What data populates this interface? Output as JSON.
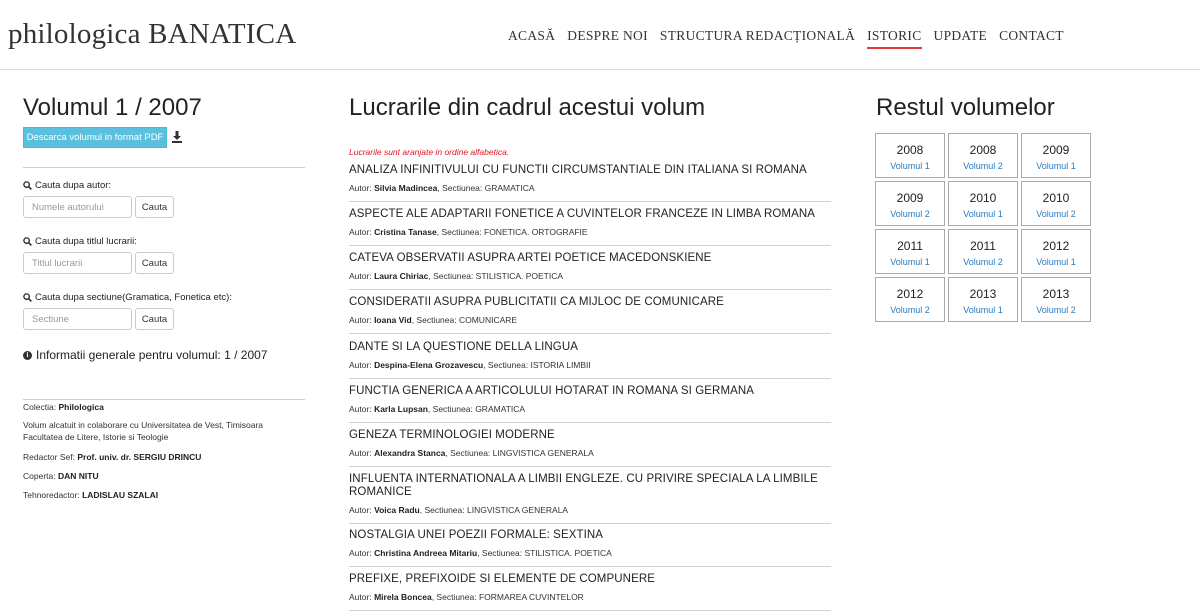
{
  "site": {
    "logo": "philologica BANATICA",
    "nav": [
      "ACASĂ",
      "DESPRE NOI",
      "STRUCTURA REDACȚIONALĂ",
      "ISTORIC",
      "UPDATE",
      "CONTACT"
    ],
    "active_nav": "ISTORIC",
    "accent_color": "#e23b3b"
  },
  "left": {
    "volume_title": "Volumul 1 / 2007",
    "pdf_button": "Descarca volumul in format PDF",
    "search_author_label": "Cauta dupa autor:",
    "search_author_placeholder": "Numele autorului",
    "search_title_label": "Cauta dupa titlul lucrarii:",
    "search_title_placeholder": "Titlul lucrarii",
    "search_section_label": "Cauta dupa sectiune(Gramatica, Fonetica etc):",
    "search_section_placeholder": "Sectiune",
    "search_button": "Cauta",
    "info_title": "Informatii generale pentru volumul: 1 / 2007",
    "collection_label": "Colectia:",
    "collection_value": "Philologica",
    "collab_line1": "Volum alcatuit in colaborare cu Universitatea de Vest, Timisoara",
    "collab_line2": "Facultatea de Litere, Istorie si Teologie",
    "editor_label": "Redactor Sef:",
    "editor_value": "Prof. univ. dr. SERGIU DRINCU",
    "cover_label": "Coperta:",
    "cover_value": "DAN NITU",
    "tech_label": "Tehnoredactor:",
    "tech_value": "LADISLAU SZALAI"
  },
  "middle": {
    "title": "Lucrarile din cadrul acestui volum",
    "note": "Lucrarile sunt aranjate in ordine alfabetica.",
    "author_prefix": "Autor:",
    "section_prefix": ", Sectiunea:",
    "articles": [
      {
        "title": "ANALIZA INFINITIVULUI CU FUNCTII CIRCUMSTANTIALE DIN ITALIANA SI ROMANA",
        "author": "Silvia Madincea",
        "section": "GRAMATICA"
      },
      {
        "title": "ASPECTE ALE ADAPTARII FONETICE A CUVINTELOR FRANCEZE IN LIMBA ROMANA",
        "author": "Cristina Tanase",
        "section": "FONETICA. ORTOGRAFIE"
      },
      {
        "title": "CATEVA OBSERVATII ASUPRA ARTEI POETICE MACEDONSKIENE",
        "author": "Laura Chiriac",
        "section": "STILISTICA. POETICA"
      },
      {
        "title": "CONSIDERATII ASUPRA PUBLICITATII CA MIJLOC DE COMUNICARE",
        "author": "Ioana Vid",
        "section": "COMUNICARE"
      },
      {
        "title": "DANTE SI LA QUESTIONE DELLA LINGUA",
        "author": "Despina-Elena Grozavescu",
        "section": "ISTORIA LIMBII"
      },
      {
        "title": "FUNCTIA GENERICA A ARTICOLULUI HOTARAT IN ROMANA SI GERMANA",
        "author": "Karla Lupsan",
        "section": "GRAMATICA"
      },
      {
        "title": "GENEZA TERMINOLOGIEI MODERNE",
        "author": "Alexandra Stanca",
        "section": "LINGVISTICA GENERALA"
      },
      {
        "title": "INFLUENTA INTERNATIONALA A LIMBII ENGLEZE. CU PRIVIRE SPECIALA LA LIMBILE ROMANICE",
        "author": "Voica Radu",
        "section": "LINGVISTICA GENERALA"
      },
      {
        "title": "NOSTALGIA UNEI POEZII FORMALE: SEXTINA",
        "author": "Christina Andreea Mitariu",
        "section": "STILISTICA. POETICA"
      },
      {
        "title": "PREFIXE, PREFIXOIDE SI ELEMENTE DE COMPUNERE",
        "author": "Mirela Boncea",
        "section": "FORMAREA CUVINTELOR"
      }
    ]
  },
  "right": {
    "title": "Restul volumelor",
    "volumes": [
      {
        "year": "2008",
        "label": "Volumul 1"
      },
      {
        "year": "2008",
        "label": "Volumul 2"
      },
      {
        "year": "2009",
        "label": "Volumul 1"
      },
      {
        "year": "2009",
        "label": "Volumul 2"
      },
      {
        "year": "2010",
        "label": "Volumul 1"
      },
      {
        "year": "2010",
        "label": "Volumul 2"
      },
      {
        "year": "2011",
        "label": "Volumul 1"
      },
      {
        "year": "2011",
        "label": "Volumul 2"
      },
      {
        "year": "2012",
        "label": "Volumul 1"
      },
      {
        "year": "2012",
        "label": "Volumul 2"
      },
      {
        "year": "2013",
        "label": "Volumul 1"
      },
      {
        "year": "2013",
        "label": "Volumul 2"
      }
    ]
  }
}
